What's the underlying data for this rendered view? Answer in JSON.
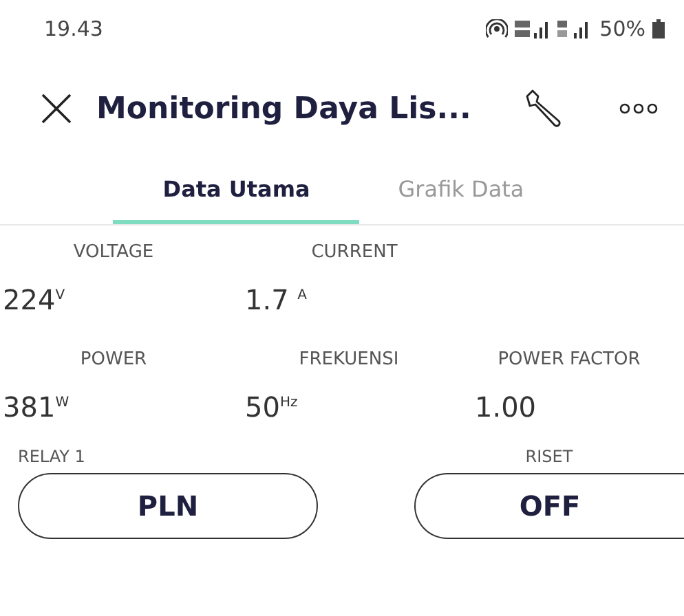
{
  "status_bar": {
    "time": "19.43",
    "battery": "50%"
  },
  "header": {
    "title": "Monitoring Daya Lis..."
  },
  "tabs": [
    {
      "label": "Data Utama",
      "selected": true
    },
    {
      "label": "Grafik Data",
      "selected": false
    }
  ],
  "readings": [
    {
      "label": "VOLTAGE",
      "value": "224$^{V}$"
    },
    {
      "label": "CURRENT",
      "value": "1.7 $^{A}$"
    },
    {
      "label": "POWER",
      "value": "381$^{W}$"
    },
    {
      "label": "FREKUENSI",
      "value": "50$^{Hz}$"
    },
    {
      "label": "POWER FACTOR",
      "value": "1.00"
    }
  ],
  "buttons": [
    {
      "label": "RELAY 1",
      "text": "PLN"
    },
    {
      "label": "RISET",
      "text": "OFF"
    }
  ]
}
